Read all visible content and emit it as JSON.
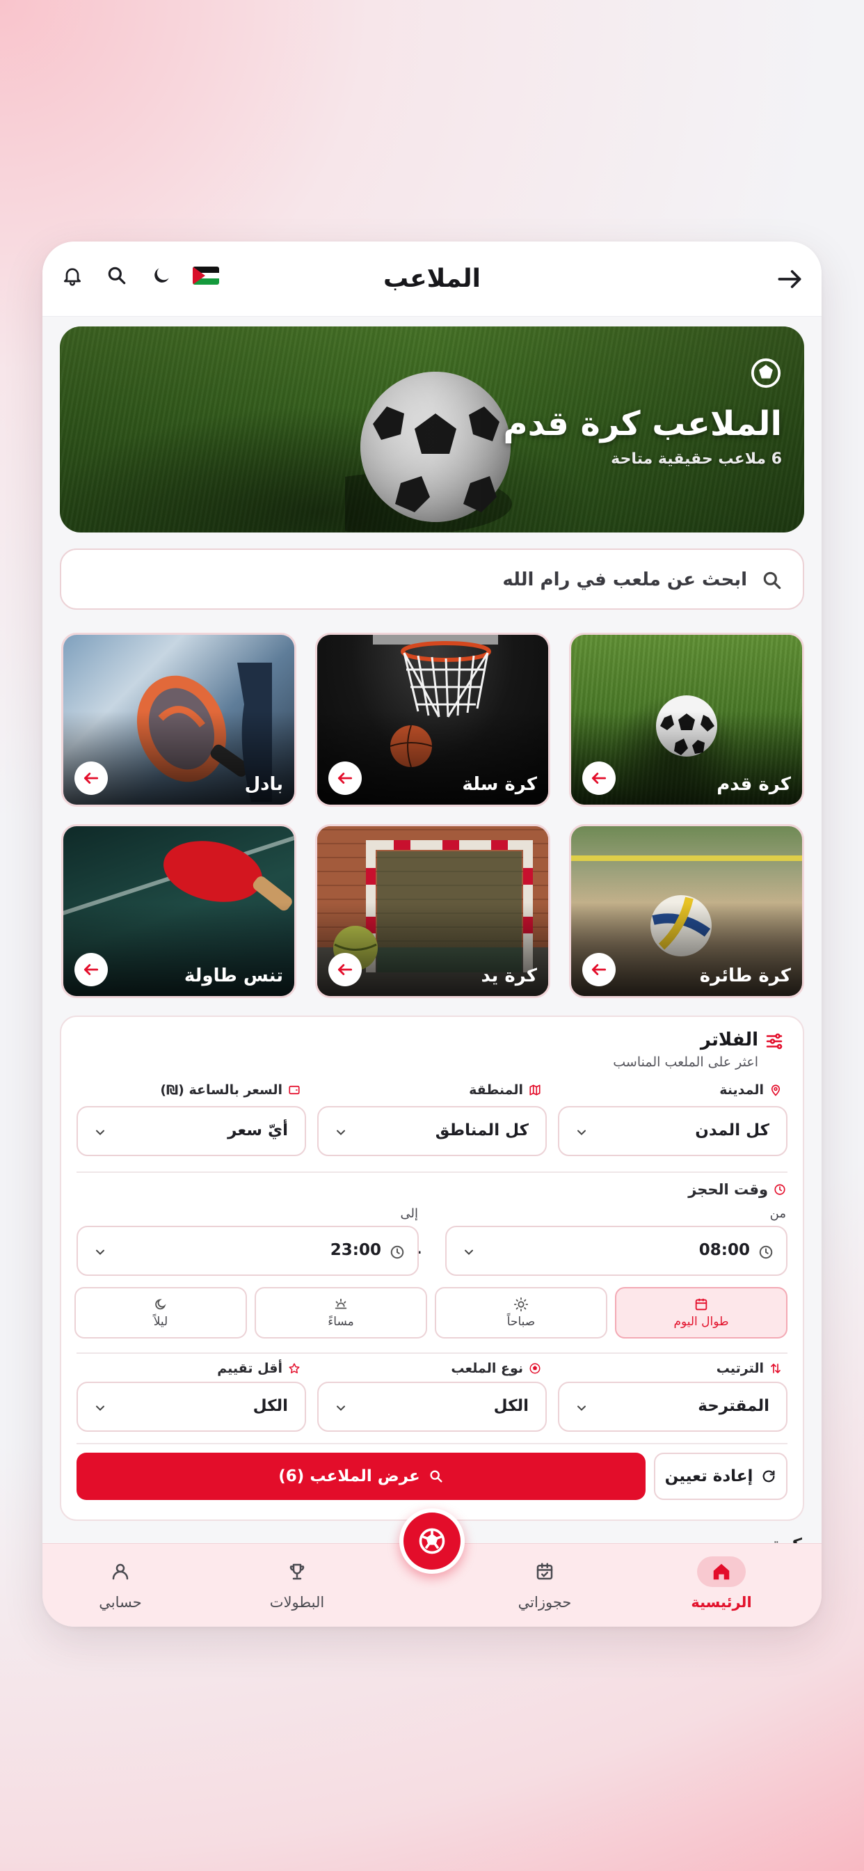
{
  "header": {
    "title": "الملاعب",
    "back_icon": "arrow-right-icon",
    "flag": "palestine-flag",
    "icons": [
      "bell-icon",
      "search-icon",
      "moon-icon"
    ]
  },
  "hero": {
    "title": "الملاعب كرة قدم",
    "subtitle": "6 ملاعب حقيقية متاحة",
    "icon": "soccer-ball-icon"
  },
  "search": {
    "placeholder": "ابحث عن ملعب في رام الله",
    "icon": "search-icon"
  },
  "sports": [
    {
      "label": "كرة قدم"
    },
    {
      "label": "كرة سلة"
    },
    {
      "label": "بادل"
    },
    {
      "label": "كرة طائرة"
    },
    {
      "label": "كرة يد"
    },
    {
      "label": "تنس طاولة"
    }
  ],
  "filters": {
    "title": "الفلاتر",
    "subtitle": "اعثر على الملعب المناسب",
    "city": {
      "label": "المدينة",
      "value": "كل المدن"
    },
    "area": {
      "label": "المنطقة",
      "value": "كل المناطق"
    },
    "price": {
      "label": "السعر بالساعة (₪)",
      "value": "أيّ سعر"
    },
    "booking_time": {
      "label": "وقت الحجز",
      "from_label": "من",
      "from_value": "08:00",
      "to_label": "إلى",
      "to_value": "23:00",
      "separator": "–"
    },
    "periods": [
      {
        "label": "طوال اليوم",
        "icon": "calendar-icon",
        "active": true
      },
      {
        "label": "صباحاً",
        "icon": "sun-icon",
        "active": false
      },
      {
        "label": "مساءً",
        "icon": "sunset-icon",
        "active": false
      },
      {
        "label": "ليلاً",
        "icon": "moon-icon",
        "active": false
      }
    ],
    "sort": {
      "label": "الترتيب",
      "value": "المقترحة"
    },
    "field_type": {
      "label": "نوع الملعب",
      "value": "الكل"
    },
    "min_rating": {
      "label": "أقل تقييم",
      "value": "الكل"
    },
    "show_button": "عرض الملاعب (6)",
    "reset_button": "إعادة تعيين"
  },
  "peek_text": "كرة",
  "bottom_nav": [
    {
      "label": "الرئيسية",
      "icon": "home-icon",
      "active": true
    },
    {
      "label": "حجوزاتي",
      "icon": "calendar-check-icon",
      "active": false
    },
    {
      "label": "البطولات",
      "icon": "trophy-icon",
      "active": false
    },
    {
      "label": "حسابي",
      "icon": "user-icon",
      "active": false
    }
  ],
  "colors": {
    "accent": "#e30d2a",
    "accent_soft": "#fde7ea",
    "background": "#f6f6f8"
  }
}
